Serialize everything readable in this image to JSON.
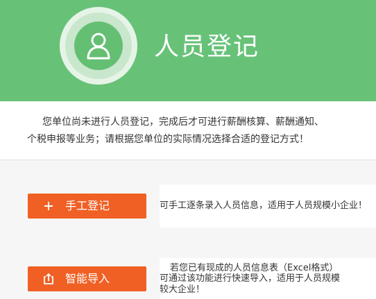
{
  "header": {
    "title": "人员登记",
    "avatar_icon": "user-icon",
    "background_color": "#67c278"
  },
  "notice": {
    "line1": "您单位尚未进行人员登记，完成后才可进行薪酬核算、薪酬通知、",
    "line2": "个税申报等业务；请根据您单位的实际情况选择合适的登记方式！"
  },
  "options": {
    "manual": {
      "button_label": "手工登记",
      "icon": "plus-icon",
      "description": "可手工逐条录入人员信息，适用于人员规模小企业！"
    },
    "import": {
      "button_label": "智能导入",
      "icon": "import-icon",
      "description_line1": "若您已有现成的人员信息表（Excel格式）",
      "description_line2": "可通过该功能进行快速导入，适用于人员规模",
      "description_line3": "较大企业！"
    }
  },
  "accent_color": "#f06025"
}
